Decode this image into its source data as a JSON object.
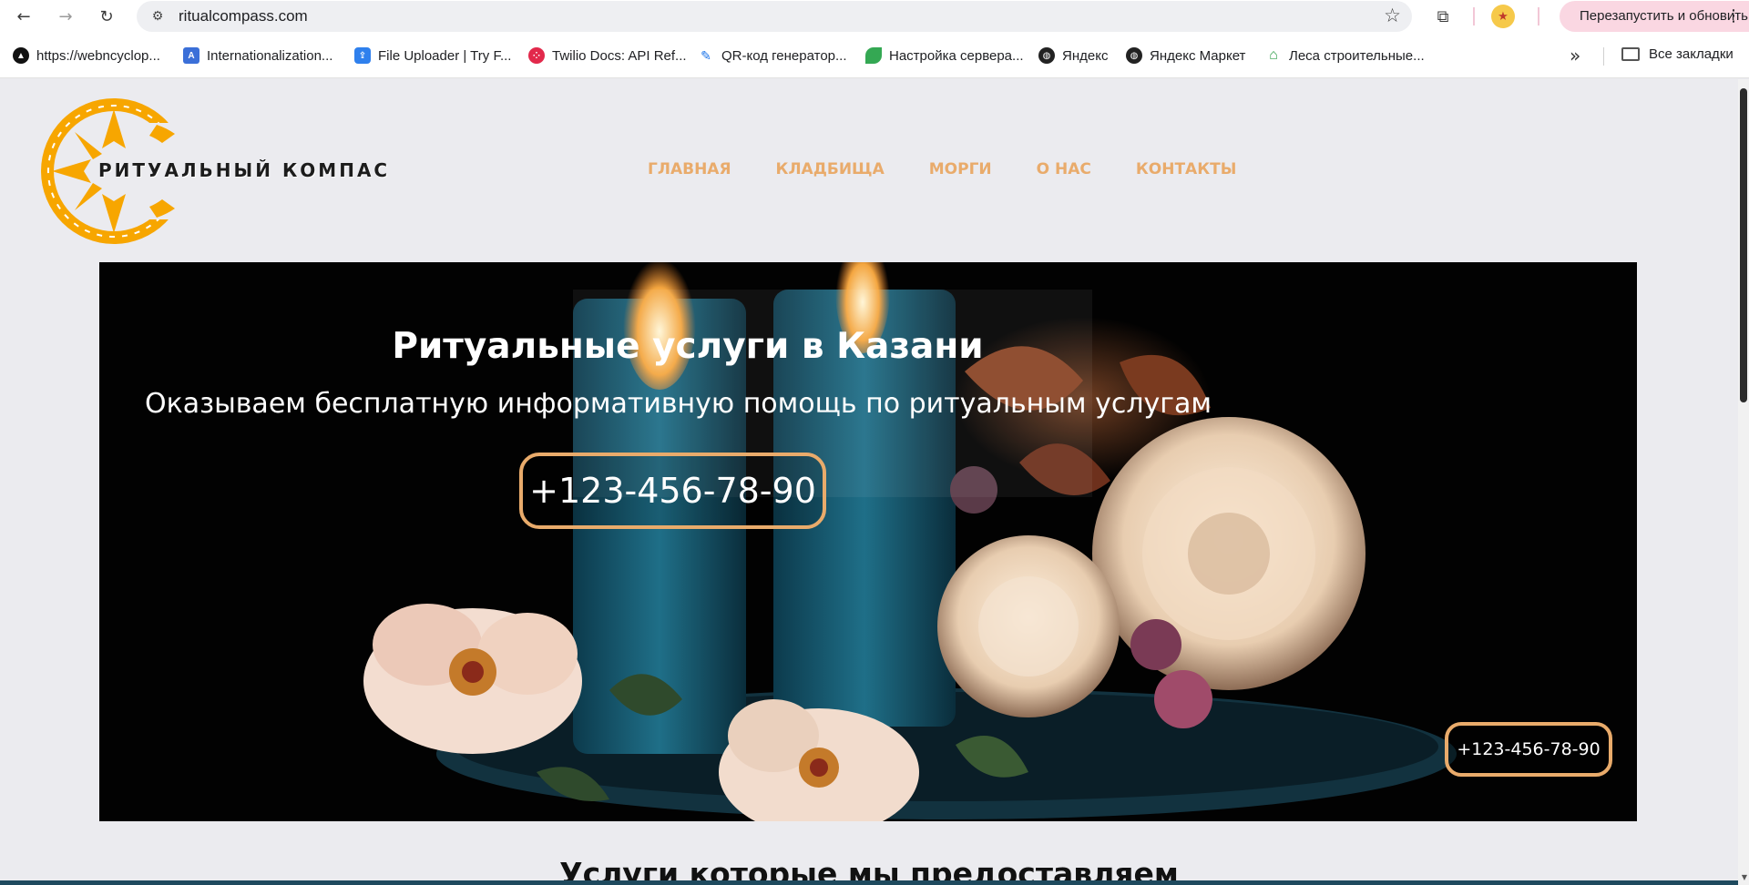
{
  "browser": {
    "url": "ritualcompass.com",
    "relaunch_label": "Перезапустить и обновить",
    "icons": {
      "back": "arrow-left-icon",
      "forward": "arrow-right-icon",
      "reload": "reload-icon",
      "site_info": "site-settings-icon",
      "bookmark_star": "star-icon",
      "extensions": "puzzle-icon",
      "menu": "kebab-menu-icon"
    },
    "bookmarks": [
      {
        "label": "https://webncyclop...",
        "color": "#111111",
        "glyph": "▲"
      },
      {
        "label": "Internationalization...",
        "color": "#3b6fd8",
        "glyph": "A"
      },
      {
        "label": "File Uploader | Try F...",
        "color": "#2f80ed",
        "glyph": "⇪"
      },
      {
        "label": "Twilio Docs: API Ref...",
        "color": "#e2294b",
        "glyph": "⁘"
      },
      {
        "label": "QR-код генератор...",
        "color": "#1a73e8",
        "glyph": "✎"
      },
      {
        "label": "Настройка сервера...",
        "color": "#34a853",
        "glyph": "●"
      },
      {
        "label": "Яндекс",
        "color": "#222222",
        "glyph": "◍"
      },
      {
        "label": "Яндекс Маркет",
        "color": "#222222",
        "glyph": "◍"
      },
      {
        "label": "Леса строительные...",
        "color": "#2e9e48",
        "glyph": "⌂"
      }
    ],
    "more_bookmarks": "»",
    "all_bookmarks": "Все закладки"
  },
  "site": {
    "logo_text": "РИТУАЛЬНЫЙ КОМПАС",
    "brand_colors": {
      "orange": "#f7a600",
      "accent": "#e9ab6b"
    },
    "nav": [
      {
        "label": "ГЛАВНАЯ"
      },
      {
        "label": "КЛАДБИЩА"
      },
      {
        "label": "МОРГИ"
      },
      {
        "label": "О НАС"
      },
      {
        "label": "КОНТАКТЫ"
      }
    ],
    "hero": {
      "title": "Ритуальные услуги в Казани",
      "subtitle": "Оказываем бесплатную информативную помощь по ритуальным услугам",
      "phone": "+123-456-78-90",
      "phone_small": "+123-456-78-90"
    },
    "services_title": "Услуги которые мы предоставляем"
  }
}
